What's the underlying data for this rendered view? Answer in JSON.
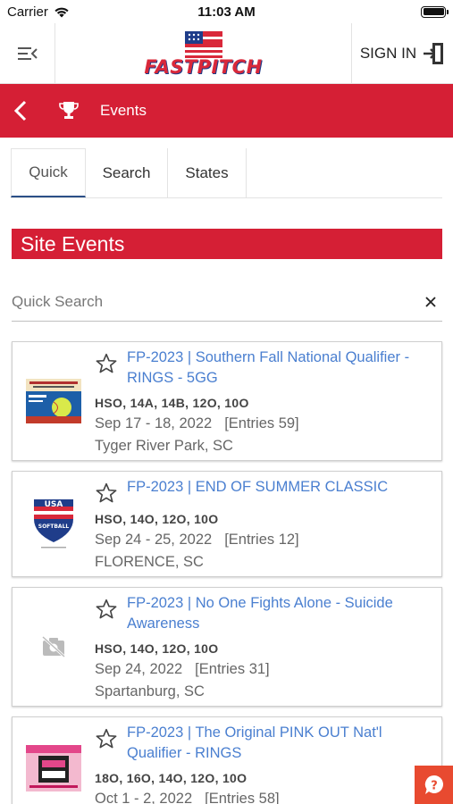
{
  "status_bar": {
    "carrier": "Carrier",
    "time": "11:03 AM"
  },
  "header": {
    "logo_text": "FASTPITCH",
    "sign_in_label": "SIGN IN"
  },
  "title_bar": {
    "title": "Events"
  },
  "tabs": [
    {
      "label": "Quick",
      "active": true
    },
    {
      "label": "Search",
      "active": false
    },
    {
      "label": "States",
      "active": false
    }
  ],
  "section_title": "Site Events",
  "search": {
    "placeholder": "Quick Search",
    "value": ""
  },
  "events": [
    {
      "title": "FP-2023 | Southern Fall National Qualifier - RINGS - 5GG",
      "divisions": "HSO, 14A, 14B, 12O, 10O",
      "date": "Sep 17 - 18, 2022",
      "entries": "[Entries 59]",
      "location": "Tyger River Park, SC",
      "thumb": "softball-flyer-image"
    },
    {
      "title": "FP-2023 | END OF SUMMER CLASSIC",
      "divisions": "HSO, 14O, 12O, 10O",
      "date": "Sep 24 - 25, 2022",
      "entries": "[Entries 12]",
      "location": "FLORENCE, SC",
      "thumb": "usa-softball-logo"
    },
    {
      "title": "FP-2023 | No One Fights Alone - Suicide Awareness",
      "divisions": "HSO, 14O, 12O, 10O",
      "date": "Sep 24, 2022",
      "entries": "[Entries 31]",
      "location": "Spartanburg, SC",
      "thumb": "no-image-icon"
    },
    {
      "title": "FP-2023 | The Original PINK OUT Nat'l Qualifier - RINGS",
      "divisions": "18O, 16O, 14O, 12O, 10O",
      "date": "Oct 1 - 2, 2022",
      "entries": "[Entries 58]",
      "location": "",
      "thumb": "pink-out-flyer-image"
    }
  ],
  "colors": {
    "brand_red": "#d51f35",
    "link_blue": "#4a7fd0",
    "help_orange": "#e84a30"
  }
}
